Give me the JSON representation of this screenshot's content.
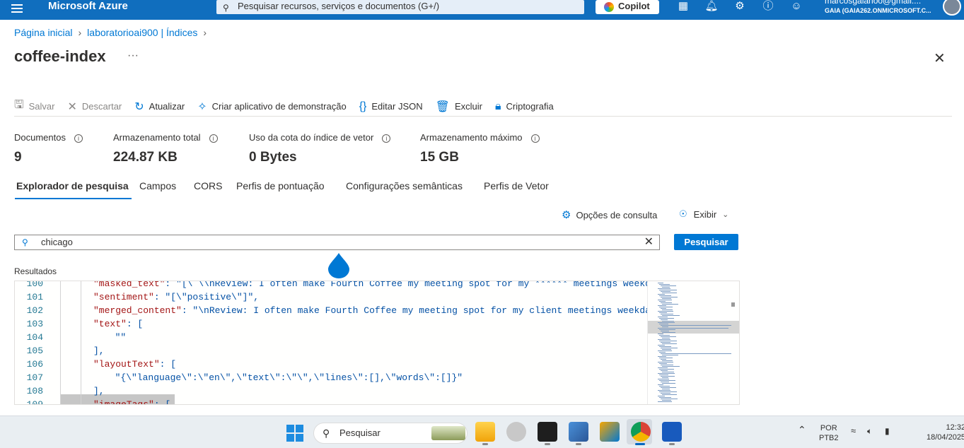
{
  "topbar": {
    "brand": "Microsoft Azure",
    "search_placeholder": "Pesquisar recursos, serviços e documentos (G+/)",
    "copilot_label": "Copilot",
    "user_email": "marcosgalanoo@gmail....",
    "user_org": "GAIA (GAIA262.ONMICROSOFT.C..."
  },
  "breadcrumb": {
    "home": "Página inicial",
    "service": "laboratorioai900 | Índices"
  },
  "page": {
    "title": "coffee-index",
    "more": "···"
  },
  "toolbar": {
    "save": "Salvar",
    "discard": "Descartar",
    "refresh": "Atualizar",
    "demo_app": "Criar aplicativo de demonstração",
    "edit_json": "Editar JSON",
    "delete": "Excluir",
    "encryption": "Criptografia"
  },
  "stats": [
    {
      "label": "Documentos",
      "value": "9"
    },
    {
      "label": "Armazenamento total",
      "value": "224.87 KB"
    },
    {
      "label": "Uso da cota do índice de vetor",
      "value": "0 Bytes"
    },
    {
      "label": "Armazenamento máximo",
      "value": "15 GB"
    }
  ],
  "tabs": [
    {
      "label": "Explorador de pesquisa",
      "active": true
    },
    {
      "label": "Campos"
    },
    {
      "label": "CORS"
    },
    {
      "label": "Perfis de pontuação"
    },
    {
      "label": "Configurações semânticas"
    },
    {
      "label": "Perfis de Vetor"
    }
  ],
  "query": {
    "options_label": "Opções de consulta",
    "view_label": "Exibir",
    "search_value": "chicago",
    "search_button": "Pesquisar",
    "results_label": "Resultados"
  },
  "editor": {
    "lines": [
      {
        "n": "100",
        "key": "\"masked_text\"",
        "rest": ": \"[\\ \\\\nReview: I often make Fourth Coffee my meeting spot for my ****** meetings weekday"
      },
      {
        "n": "101",
        "key": "\"sentiment\"",
        "rest": ": \"[\\\"positive\\\"]\","
      },
      {
        "n": "102",
        "key": "\"merged_content\"",
        "rest": ": \"\\nReview: I often make Fourth Coffee my meeting spot for my client meetings weekday"
      },
      {
        "n": "103",
        "key": "\"text\"",
        "rest": ": ["
      },
      {
        "n": "104",
        "key": "",
        "rest": "  \"\""
      },
      {
        "n": "105",
        "key": "",
        "rest": "],"
      },
      {
        "n": "106",
        "key": "\"layoutText\"",
        "rest": ": ["
      },
      {
        "n": "107",
        "key": "",
        "rest": "  \"{\\\"language\\\":\\\"en\\\",\\\"text\\\":\\\"\\\",\\\"lines\\\":[],\\\"words\\\":[]}\""
      },
      {
        "n": "108",
        "key": "",
        "rest": "],"
      },
      {
        "n": "109",
        "key": "\"imageTags\"",
        "rest": ": ["
      }
    ]
  },
  "taskbar": {
    "search_label": "Pesquisar",
    "lang1": "POR",
    "lang2": "PTB2",
    "time": "12:32",
    "date": "18/04/2025"
  }
}
